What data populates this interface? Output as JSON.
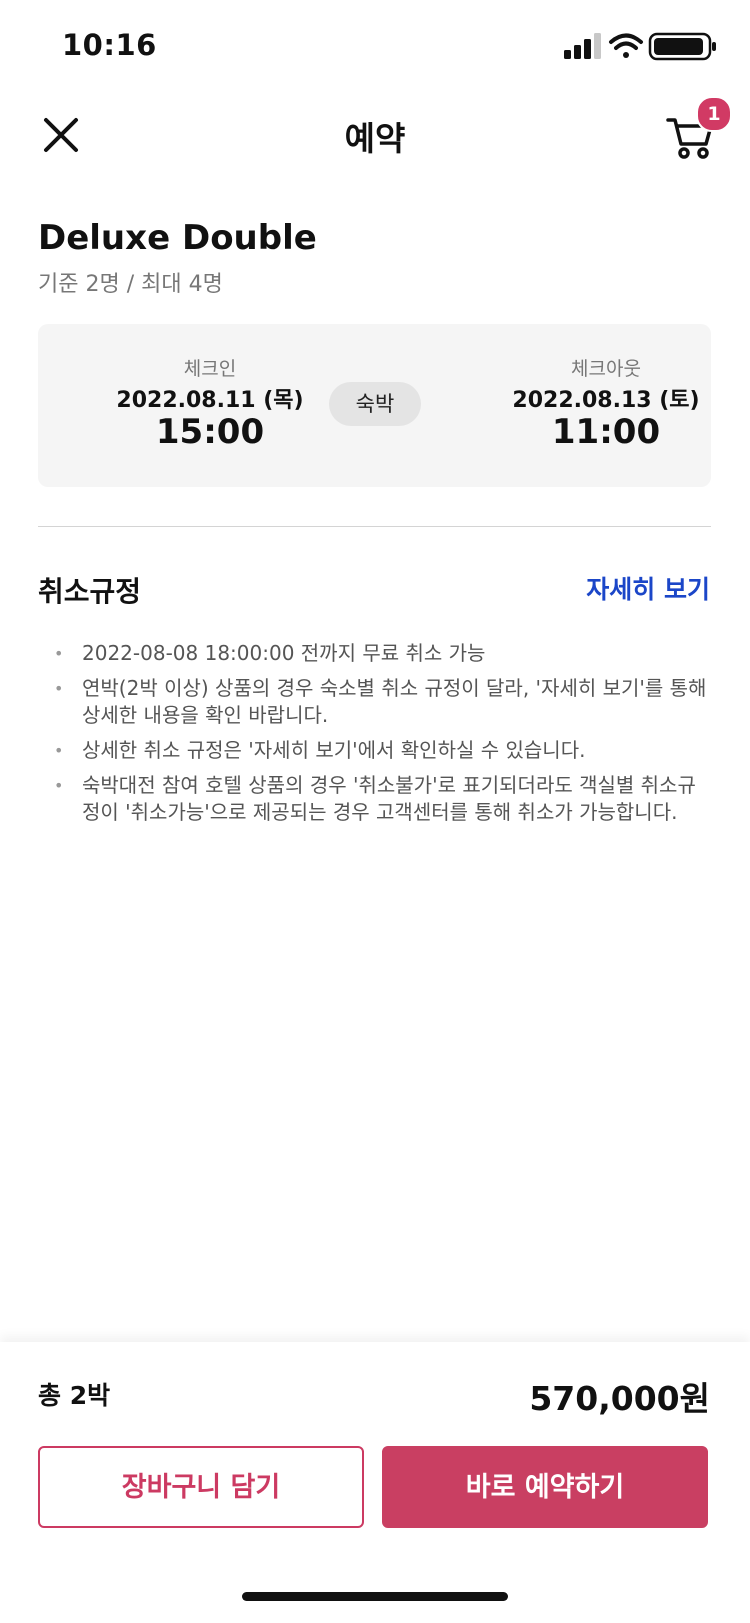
{
  "status_bar": {
    "time": "10:16"
  },
  "nav": {
    "title": "예약",
    "cart_count": "1"
  },
  "room": {
    "name": "Deluxe Double",
    "capacity": "기준 2명 / 최대 4명"
  },
  "stay": {
    "checkin": {
      "label": "체크인",
      "date": "2022.08.11 (목)",
      "time": "15:00"
    },
    "checkout": {
      "label": "체크아웃",
      "date": "2022.08.13 (토)",
      "time": "11:00"
    },
    "type": "숙박"
  },
  "policy": {
    "title": "취소규정",
    "more_label": "자세히 보기",
    "items": [
      "2022-08-08 18:00:00 전까지 무료 취소 가능",
      "연박(2박 이상) 상품의 경우 숙소별 취소 규정이 달라, '자세히 보기'를 통해 상세한 내용을 확인 바랍니다.",
      "상세한 취소 규정은 '자세히 보기'에서 확인하실 수 있습니다.",
      "숙박대전 참여 호텔 상품의 경우 '취소불가'로 표기되더라도 객실별 취소규정이 '취소가능'으로 제공되는 경우 고객센터를 통해 취소가 가능합니다."
    ]
  },
  "summary": {
    "nights_label": "총 2박",
    "total_price": "570,000원"
  },
  "actions": {
    "cart_label": "장바구니 담기",
    "book_label": "바로 예약하기"
  },
  "colors": {
    "accent": "#c93f62",
    "link": "#1b46c8",
    "badge": "#d13a64"
  }
}
